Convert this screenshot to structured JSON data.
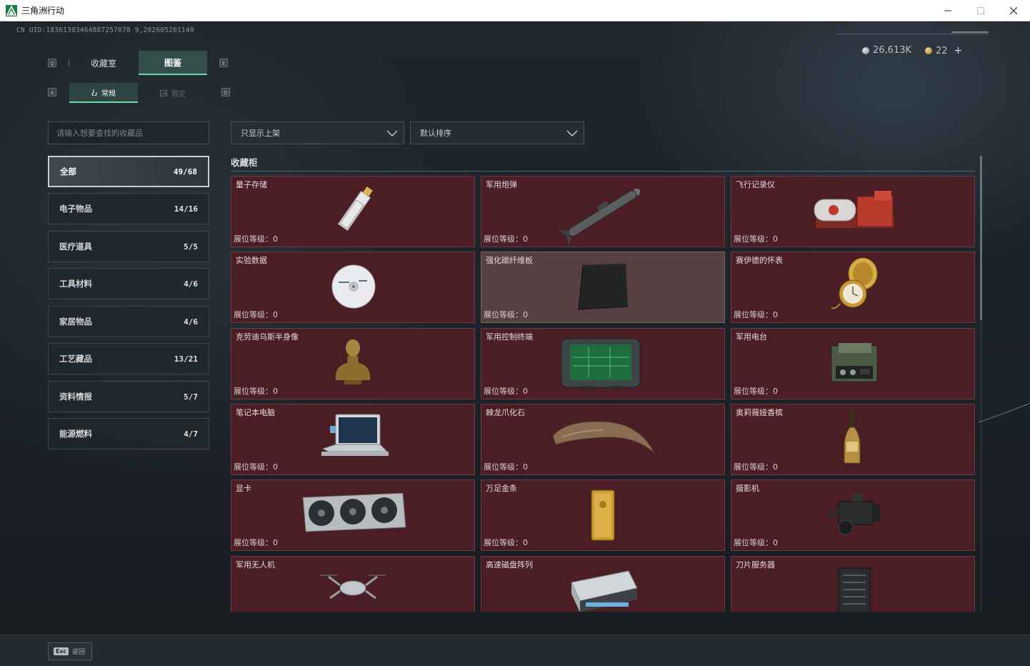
{
  "window": {
    "title": "三角洲行动"
  },
  "header": {
    "uid": "CN UID:18361303464887257078 9,202605201140",
    "currency": [
      {
        "icon": "silver-coin-icon",
        "value": "26,613K"
      },
      {
        "icon": "gold-coin-icon",
        "value": "22"
      }
    ],
    "add_label": "+"
  },
  "tabs": {
    "left_key": "Q",
    "right_key": "E",
    "items": [
      {
        "label": "收藏室",
        "active": false
      },
      {
        "label": "图鉴",
        "active": true
      }
    ]
  },
  "subtabs": {
    "left_key": "A",
    "right_key": "D",
    "items": [
      {
        "label": "常规",
        "icon": "hand-icon",
        "active": true
      },
      {
        "label": "限定",
        "icon": "image-icon",
        "active": false
      }
    ]
  },
  "search": {
    "placeholder": "请输入想要查找的收藏品"
  },
  "categories": [
    {
      "label": "全部",
      "count": "49/68",
      "active": true
    },
    {
      "label": "电子物品",
      "count": "14/16"
    },
    {
      "label": "医疗道具",
      "count": "5/5"
    },
    {
      "label": "工具材料",
      "count": "4/6"
    },
    {
      "label": "家居物品",
      "count": "4/6"
    },
    {
      "label": "工艺藏品",
      "count": "13/21"
    },
    {
      "label": "资料情报",
      "count": "5/7"
    },
    {
      "label": "能源燃料",
      "count": "4/7"
    }
  ],
  "filters": {
    "availability": "只显示上架",
    "sort": "默认排序"
  },
  "section": {
    "title": "收藏柜"
  },
  "items": [
    {
      "name": "量子存储",
      "level": "展位等级：0",
      "icon": "usb-drive-icon"
    },
    {
      "name": "军用炮弹",
      "level": "展位等级：0",
      "icon": "missile-icon"
    },
    {
      "name": "飞行记录仪",
      "level": "展位等级：0",
      "icon": "flight-recorder-icon"
    },
    {
      "name": "实验数据",
      "level": "展位等级：0",
      "icon": "disc-icon"
    },
    {
      "name": "强化碳纤维板",
      "level": "展位等级：0",
      "icon": "carbon-plate-icon",
      "highlight": true
    },
    {
      "name": "赛伊德的怀表",
      "level": "展位等级：0",
      "icon": "pocket-watch-icon"
    },
    {
      "name": "克劳迪乌斯半身像",
      "level": "展位等级：0",
      "icon": "bust-icon"
    },
    {
      "name": "军用控制终端",
      "level": "展位等级：0",
      "icon": "control-terminal-icon"
    },
    {
      "name": "军用电台",
      "level": "展位等级：0",
      "icon": "radio-icon"
    },
    {
      "name": "笔记本电脑",
      "level": "展位等级：0",
      "icon": "laptop-icon"
    },
    {
      "name": "棘龙爪化石",
      "level": "展位等级：0",
      "icon": "claw-fossil-icon"
    },
    {
      "name": "奥莉薇娅香槟",
      "level": "展位等级：0",
      "icon": "champagne-icon"
    },
    {
      "name": "显卡",
      "level": "展位等级：0",
      "icon": "graphics-card-icon"
    },
    {
      "name": "万足金条",
      "level": "展位等级：0",
      "icon": "gold-bar-icon"
    },
    {
      "name": "摄影机",
      "level": "展位等级：0",
      "icon": "camera-icon"
    },
    {
      "name": "军用无人机",
      "level": "",
      "icon": "drone-icon"
    },
    {
      "name": "高速磁盘阵列",
      "level": "",
      "icon": "disk-array-icon"
    },
    {
      "name": "刀片服务器",
      "level": "",
      "icon": "blade-server-icon"
    }
  ],
  "footer": {
    "esc_key": "Esc",
    "back_label": "返回"
  },
  "colors": {
    "accent": "#6fd6a6",
    "card_bg": "#4a1e24",
    "card_highlight": "#564044"
  }
}
